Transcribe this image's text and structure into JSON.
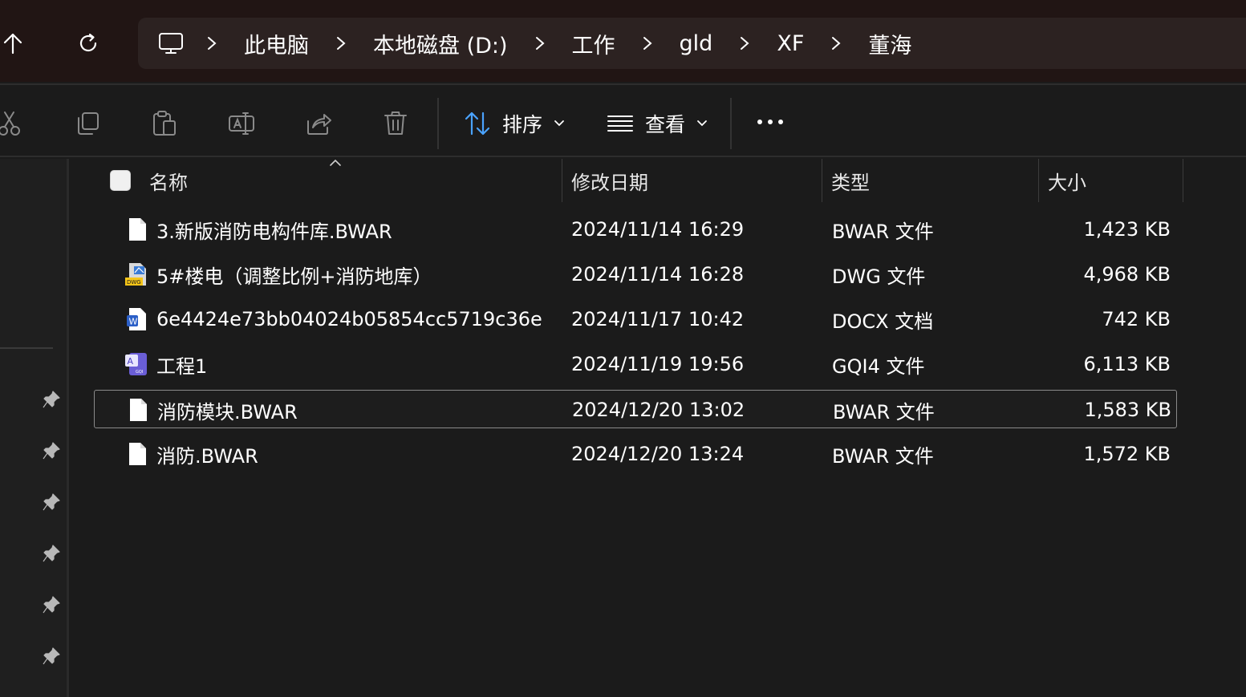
{
  "address_bar": {
    "crumbs": [
      "此电脑",
      "本地磁盘 (D:)",
      "工作",
      "gld",
      "XF",
      "董海"
    ]
  },
  "toolbar": {
    "sort_label": "排序",
    "view_label": "查看"
  },
  "columns": {
    "name": "名称",
    "modified": "修改日期",
    "type": "类型",
    "size": "大小"
  },
  "files": [
    {
      "name": "3.新版消防电构件库.BWAR",
      "modified": "2024/11/14 16:29",
      "type": "BWAR 文件",
      "size": "1,423 KB",
      "icon": "blank-file-icon"
    },
    {
      "name": "5#楼电（调整比例+消防地库）",
      "modified": "2024/11/14 16:28",
      "type": "DWG 文件",
      "size": "4,968 KB",
      "icon": "dwg-file-icon"
    },
    {
      "name": "6e4424e73bb04024b05854cc5719c36e",
      "modified": "2024/11/17 10:42",
      "type": "DOCX 文档",
      "size": "742 KB",
      "icon": "word-file-icon"
    },
    {
      "name": "工程1",
      "modified": "2024/11/19 19:56",
      "type": "GQI4 文件",
      "size": "6,113 KB",
      "icon": "gqi-file-icon"
    },
    {
      "name": "消防模块.BWAR",
      "modified": "2024/12/20 13:02",
      "type": "BWAR 文件",
      "size": "1,583 KB",
      "icon": "blank-file-icon",
      "selected": true
    },
    {
      "name": "消防.BWAR",
      "modified": "2024/12/20 13:24",
      "type": "BWAR 文件",
      "size": "1,572 KB",
      "icon": "blank-file-icon"
    }
  ],
  "colors": {
    "accent": "#4aa3ff",
    "background": "#1b1b1b",
    "topbar": "#211514",
    "address": "#2c2221"
  }
}
